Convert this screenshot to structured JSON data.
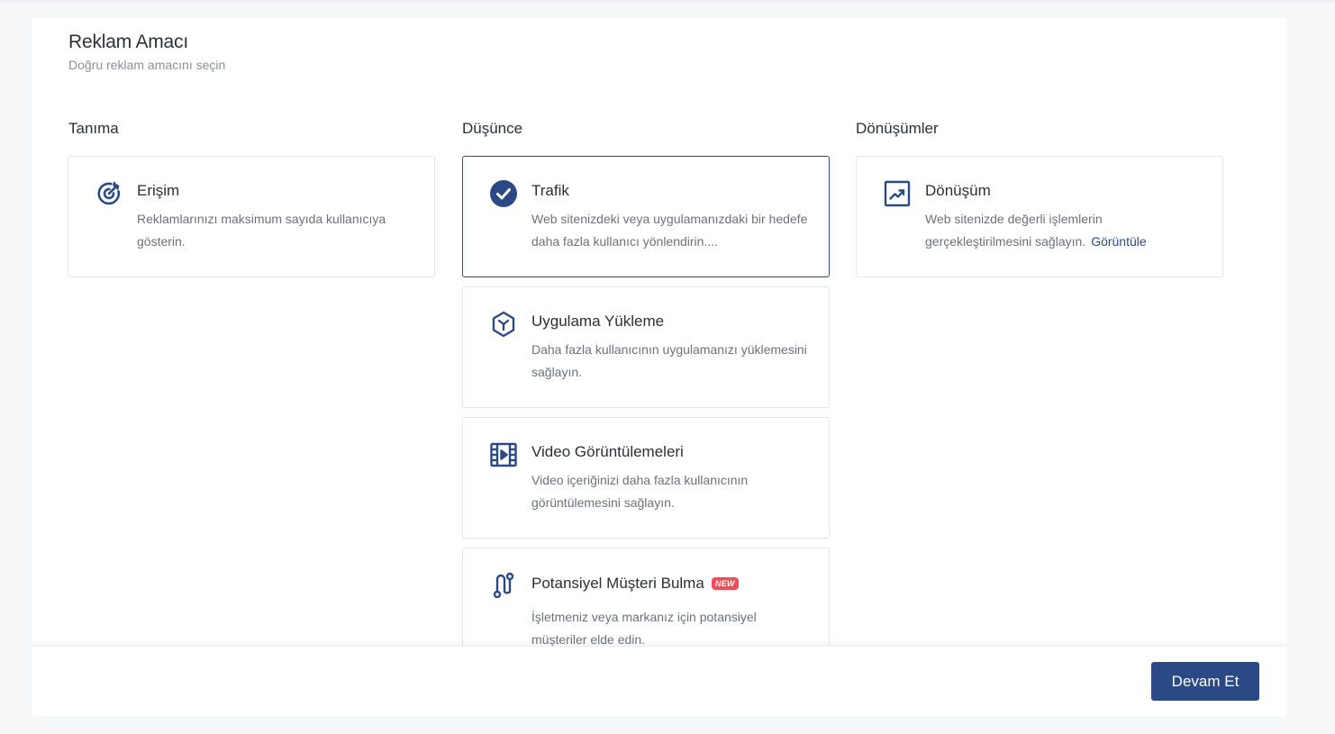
{
  "header": {
    "title": "Reklam Amacı",
    "subtitle": "Doğru reklam amacını seçin"
  },
  "columns": [
    {
      "heading": "Tanıma",
      "cards": [
        {
          "icon": "target-icon",
          "title": "Erişim",
          "description": "Reklamlarınızı maksimum sayıda kullanıcıya gösterin.",
          "selected": false
        }
      ]
    },
    {
      "heading": "Düşünce",
      "cards": [
        {
          "icon": "check-circle-icon",
          "title": "Trafik",
          "description": "Web sitenizdeki veya uygulamanızdaki bir hedefe daha fazla kullanıcı yönlendirin....",
          "selected": true
        },
        {
          "icon": "cube-icon",
          "title": "Uygulama Yükleme",
          "description": "Daha fazla kullanıcının uygulamanızı yüklemesini sağlayın.",
          "selected": false
        },
        {
          "icon": "video-film-icon",
          "title": "Video Görüntülemeleri",
          "description": "Video içeriğinizi daha fazla kullanıcının görüntülemesini sağlayın.",
          "selected": false
        },
        {
          "icon": "route-icon",
          "title": "Potansiyel Müşteri Bulma",
          "badge": "NEW",
          "description": "İşletmeniz veya markanız için potansiyel müşteriler elde edin.",
          "selected": false
        }
      ]
    },
    {
      "heading": "Dönüşümler",
      "cards": [
        {
          "icon": "trending-up-chart-icon",
          "title": "Dönüşüm",
          "description": "Web sitenizde değerli işlemlerin gerçekleştirilmesini sağlayın.",
          "link": "Görüntüle",
          "selected": false
        }
      ]
    }
  ],
  "footer": {
    "continue_label": "Devam Et"
  },
  "colors": {
    "accent": "#2b4a85",
    "badge": "#ef4d57",
    "background": "#f6f7f9"
  }
}
